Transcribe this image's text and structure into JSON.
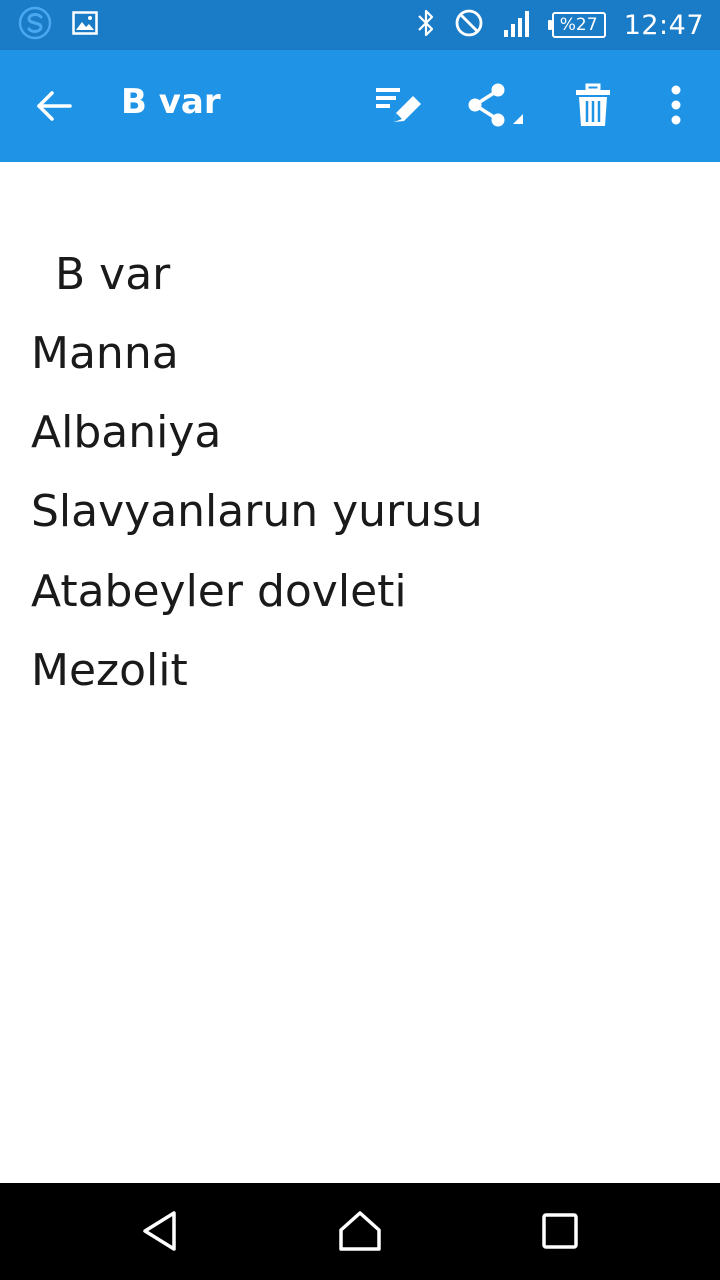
{
  "status_bar": {
    "time": "12:47",
    "battery_label": "%27",
    "icons": [
      "sync-app-icon",
      "image-notification-icon",
      "bluetooth-icon",
      "do-not-disturb-icon",
      "signal-icon",
      "battery-icon"
    ]
  },
  "app_bar": {
    "title": "B var",
    "actions": [
      "back-arrow-icon",
      "edit-note-icon",
      "share-icon",
      "trash-icon",
      "more-vert-icon"
    ]
  },
  "note": {
    "lines": [
      "B var",
      "Manna",
      "Albaniya",
      "Slavyanlarun yurusu",
      "Atabeyler dovleti",
      "Mezolit"
    ]
  },
  "nav_bar": {
    "buttons": [
      "back-triangle-icon",
      "home-icon",
      "recents-icon"
    ]
  },
  "colors": {
    "status_bar": "#1a7bc7",
    "app_bar": "#1f93e6",
    "nav_bar": "#000000",
    "text": "#1a1a1a"
  }
}
